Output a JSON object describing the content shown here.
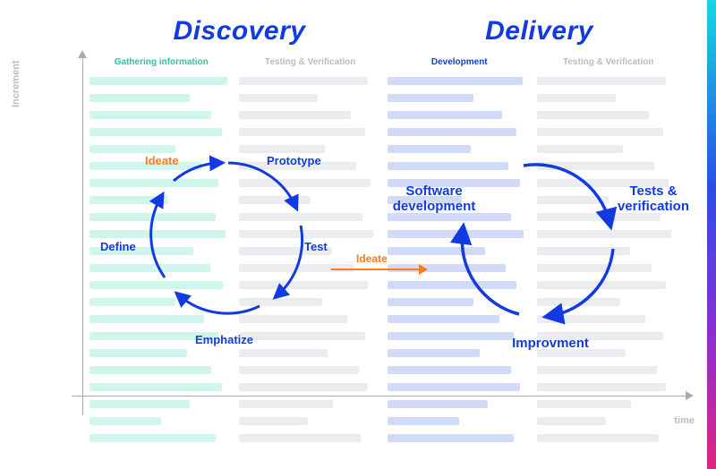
{
  "axes": {
    "y": "Increment",
    "x": "time"
  },
  "phases": {
    "discovery": {
      "title": "Discovery"
    },
    "delivery": {
      "title": "Delivery"
    }
  },
  "columns": [
    {
      "label": "Gathering information",
      "tone": "teal"
    },
    {
      "label": "Testing & Verification",
      "tone": "grey"
    },
    {
      "label": "Development",
      "tone": "blue"
    },
    {
      "label": "Testing & Verification",
      "tone": "grey"
    }
  ],
  "discovery_cycle": {
    "ideate": "Ideate",
    "prototype": "Prototype",
    "test": "Test",
    "emphatize": "Emphatize",
    "define": "Define"
  },
  "connector": {
    "label": "Ideate"
  },
  "delivery_cycle": {
    "software_dev": "Software\ndevelopment",
    "tests": "Tests &\nverification",
    "improvement": "Improvment"
  }
}
